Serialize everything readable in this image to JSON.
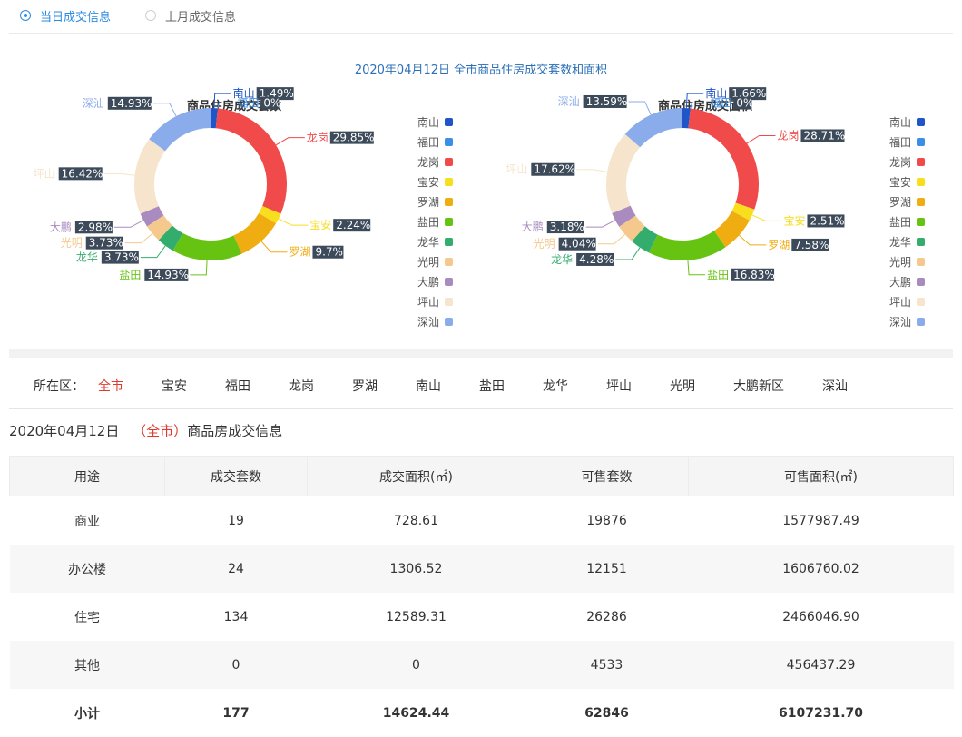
{
  "tabs": {
    "today": "当日成交信息",
    "last_month": "上月成交信息",
    "selected": "today"
  },
  "main_title": "2020年04月12日 全市商品住房成交套数和面积",
  "chart_data": [
    {
      "type": "pie",
      "title": "商品住房成交套数",
      "slices": [
        {
          "name": "南山",
          "value": 1.49,
          "label": "1.49%",
          "color": "#1f55c8"
        },
        {
          "name": "福田",
          "value": 0,
          "label": "0%",
          "color": "#3a8ee6"
        },
        {
          "name": "龙岗",
          "value": 29.85,
          "label": "29.85%",
          "color": "#f04a4a"
        },
        {
          "name": "宝安",
          "value": 2.24,
          "label": "2.24%",
          "color": "#f8de1c"
        },
        {
          "name": "罗湖",
          "value": 9.7,
          "label": "9.7%",
          "color": "#f0ad12"
        },
        {
          "name": "盐田",
          "value": 14.93,
          "label": "14.93%",
          "color": "#66c312"
        },
        {
          "name": "龙华",
          "value": 3.73,
          "label": "3.73%",
          "color": "#33ad6e"
        },
        {
          "name": "光明",
          "value": 3.73,
          "label": "3.73%",
          "color": "#f5c98d"
        },
        {
          "name": "大鹏",
          "value": 2.98,
          "label": "2.98%",
          "color": "#a98bbf"
        },
        {
          "name": "坪山",
          "value": 16.42,
          "label": "16.42%",
          "color": "#f6e5cc"
        },
        {
          "name": "深汕",
          "value": 14.93,
          "label": "14.93%",
          "color": "#8bacea"
        }
      ]
    },
    {
      "type": "pie",
      "title": "商品住房成交面积",
      "slices": [
        {
          "name": "南山",
          "value": 1.66,
          "label": "1.66%",
          "color": "#1f55c8"
        },
        {
          "name": "福田",
          "value": 0,
          "label": "0%",
          "color": "#3a8ee6"
        },
        {
          "name": "龙岗",
          "value": 28.71,
          "label": "28.71%",
          "color": "#f04a4a"
        },
        {
          "name": "宝安",
          "value": 2.51,
          "label": "2.51%",
          "color": "#f8de1c"
        },
        {
          "name": "罗湖",
          "value": 7.58,
          "label": "7.58%",
          "color": "#f0ad12"
        },
        {
          "name": "盐田",
          "value": 16.83,
          "label": "16.83%",
          "color": "#66c312"
        },
        {
          "name": "龙华",
          "value": 4.28,
          "label": "4.28%",
          "color": "#33ad6e"
        },
        {
          "name": "光明",
          "value": 4.04,
          "label": "4.04%",
          "color": "#f5c98d"
        },
        {
          "name": "大鹏",
          "value": 3.18,
          "label": "3.18%",
          "color": "#a98bbf"
        },
        {
          "name": "坪山",
          "value": 17.62,
          "label": "17.62%",
          "color": "#f6e5cc"
        },
        {
          "name": "深汕",
          "value": 13.59,
          "label": "13.59%",
          "color": "#8bacea"
        }
      ]
    }
  ],
  "district_filter": {
    "label": "所在区：",
    "items": [
      "全市",
      "宝安",
      "福田",
      "龙岗",
      "罗湖",
      "南山",
      "盐田",
      "龙华",
      "坪山",
      "光明",
      "大鹏新区",
      "深汕"
    ],
    "active": "全市"
  },
  "subtitle": {
    "date": "2020年04月12日",
    "open": "（",
    "district": "全市",
    "close": "）",
    "suffix": "商品房成交信息"
  },
  "table": {
    "headers": [
      "用途",
      "成交套数",
      "成交面积(㎡)",
      "可售套数",
      "可售面积(㎡)"
    ],
    "rows": [
      [
        "商业",
        "19",
        "728.61",
        "19876",
        "1577987.49"
      ],
      [
        "办公楼",
        "24",
        "1306.52",
        "12151",
        "1606760.02"
      ],
      [
        "住宅",
        "134",
        "12589.31",
        "26286",
        "2466046.90"
      ],
      [
        "其他",
        "0",
        "0",
        "4533",
        "456437.29"
      ]
    ],
    "total": [
      "小计",
      "177",
      "14624.44",
      "62846",
      "6107231.70"
    ]
  }
}
